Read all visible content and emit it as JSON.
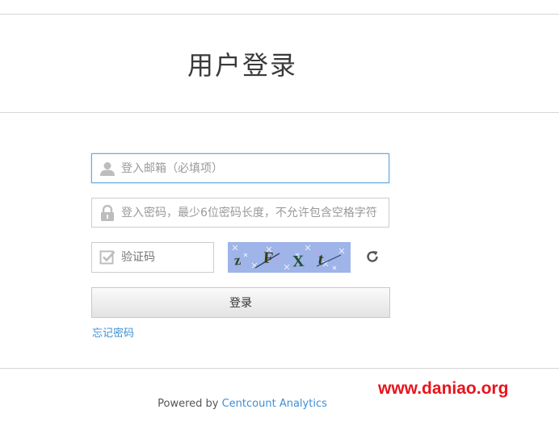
{
  "header": {
    "title": "用户登录"
  },
  "form": {
    "email": {
      "placeholder": "登入邮箱（必填项）",
      "value": "",
      "icon": "user-icon"
    },
    "password": {
      "placeholder": "登入密码，最少6位密码长度，不允许包含空格字符",
      "value": "",
      "icon": "lock-icon"
    },
    "captcha": {
      "placeholder": "验证码",
      "value": "",
      "icon": "checkbox-icon",
      "image_text": "zFXt",
      "refresh_icon": "refresh-icon"
    },
    "login_label": "登录",
    "forgot_label": "忘记密码"
  },
  "footer": {
    "powered_by": "Powered by",
    "brand": "Centcount Analytics"
  },
  "watermark": "www.daniao.org",
  "colors": {
    "link": "#3c8fd6",
    "focus_border": "#66a9dd",
    "watermark": "#e8141c",
    "captcha_bg": "#9fb4e8"
  }
}
